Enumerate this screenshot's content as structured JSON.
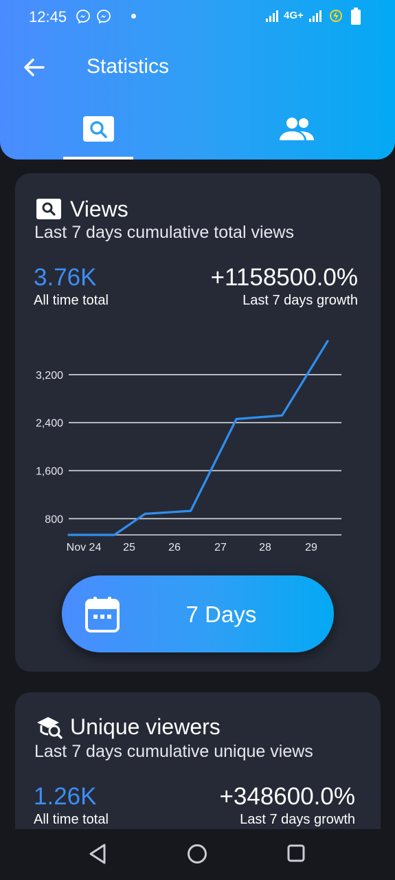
{
  "status": {
    "time": "12:45",
    "network": "4G+"
  },
  "header": {
    "title": "Statistics"
  },
  "tabs": [
    {
      "icon": "search-box-icon",
      "selected": true
    },
    {
      "icon": "people-icon",
      "selected": false
    }
  ],
  "views": {
    "title": "Views",
    "subtitle": "Last 7 days cumulative total views",
    "total_value": "3.76K",
    "total_label": "All time total",
    "growth_value": "+1158500.0%",
    "growth_label": "Last 7 days growth",
    "range_button": "7 Days"
  },
  "unique": {
    "title": "Unique viewers",
    "subtitle": "Last 7 days cumulative unique views",
    "total_value": "1.26K",
    "total_label": "All time total",
    "growth_value": "+348600.0%",
    "growth_label": "Last 7 days growth"
  },
  "chart_data": {
    "type": "line",
    "title": "",
    "xlabel": "",
    "ylabel": "",
    "x_tick_labels": [
      "Nov 24",
      "25",
      "26",
      "27",
      "28",
      "29"
    ],
    "y_tick_labels": [
      "800",
      "1,600",
      "2,400",
      "3,200"
    ],
    "y_ticks": [
      800,
      1600,
      2400,
      3200
    ],
    "ylim": [
      530,
      3760
    ],
    "x_range": [
      0,
      6
    ],
    "series": [
      {
        "color": "#2f8ff0",
        "points": [
          [
            0,
            530
          ],
          [
            1,
            530
          ],
          [
            1.67,
            880
          ],
          [
            2.67,
            930
          ],
          [
            3.67,
            2460
          ],
          [
            4.67,
            2520
          ],
          [
            5.67,
            3760
          ]
        ]
      }
    ],
    "grid": true,
    "line_color": "#2f8ff0"
  }
}
